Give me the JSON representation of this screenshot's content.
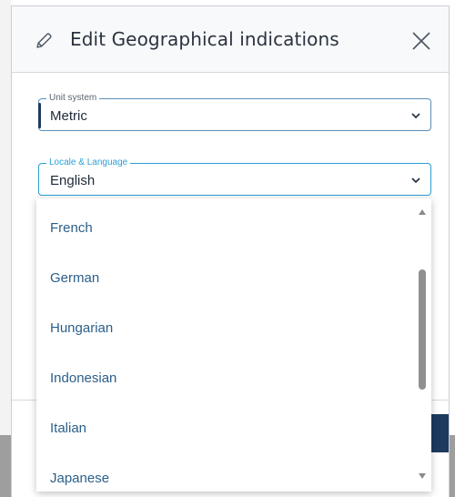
{
  "dialog": {
    "title": "Edit Geographical indications",
    "icons": {
      "title_icon": "pencil-icon",
      "close": "close-icon"
    }
  },
  "fields": {
    "unit_system": {
      "label": "Unit system",
      "value": "Metric"
    },
    "locale": {
      "label": "Locale & Language",
      "value": "English"
    }
  },
  "dropdown": {
    "options": [
      "French",
      "German",
      "Hungarian",
      "Indonesian",
      "Italian",
      "Japanese"
    ]
  },
  "colors": {
    "accent": "#2a9fd6",
    "primary": "#1e3a5f",
    "option_text": "#2b5f8a"
  }
}
